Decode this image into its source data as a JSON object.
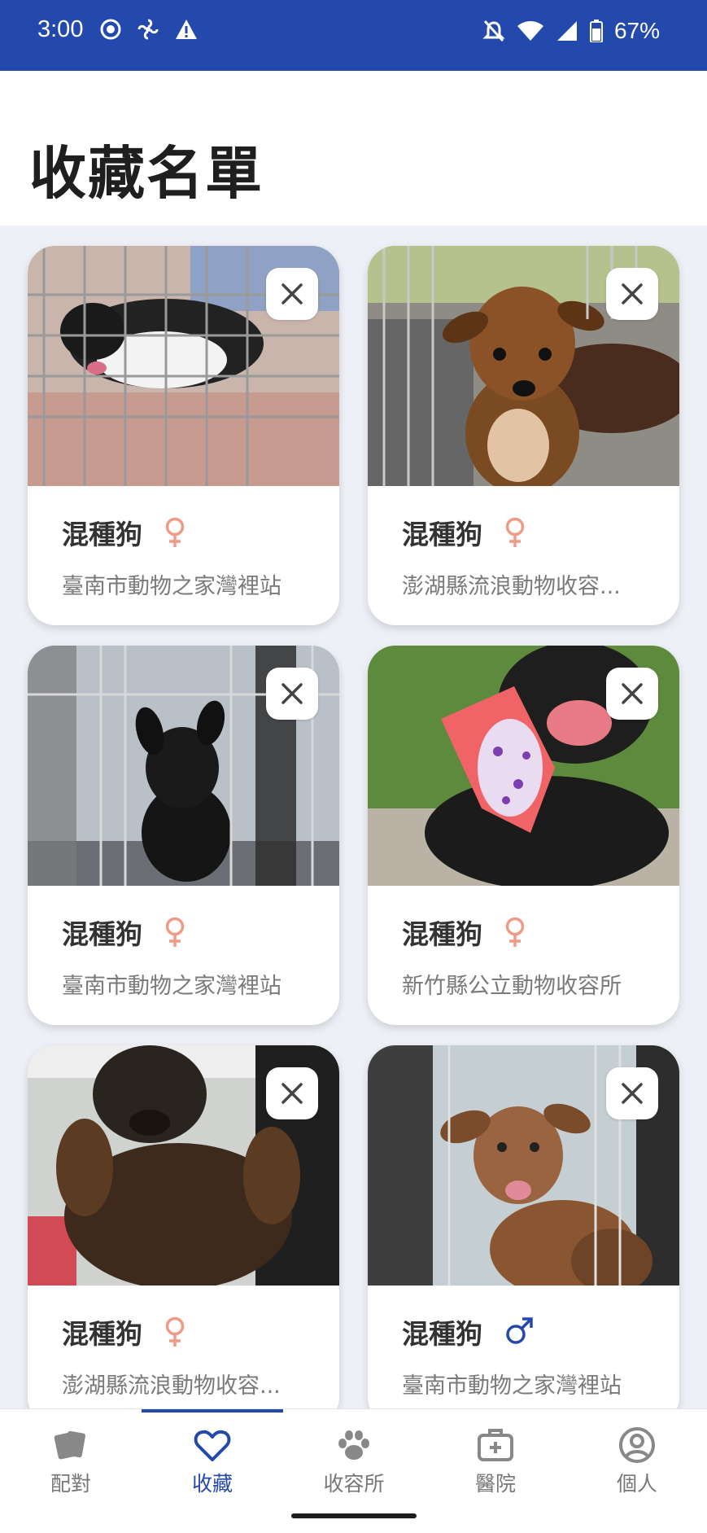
{
  "status_bar": {
    "time": "3:00",
    "battery": "67%"
  },
  "header": {
    "title": "收藏名單"
  },
  "cards": [
    {
      "name": "混種狗",
      "gender": "female",
      "gender_icon": "female-icon",
      "shelter": "臺南市動物之家灣裡站"
    },
    {
      "name": "混種狗",
      "gender": "female",
      "gender_icon": "female-icon",
      "shelter": "澎湖縣流浪動物收容..."
    },
    {
      "name": "混種狗",
      "gender": "female",
      "gender_icon": "female-icon",
      "shelter": "臺南市動物之家灣裡站"
    },
    {
      "name": "混種狗",
      "gender": "female",
      "gender_icon": "female-icon",
      "shelter": "新竹縣公立動物收容所"
    },
    {
      "name": "混種狗",
      "gender": "female",
      "gender_icon": "female-icon",
      "shelter": "澎湖縣流浪動物收容..."
    },
    {
      "name": "混種狗",
      "gender": "male",
      "gender_icon": "male-icon",
      "shelter": "臺南市動物之家灣裡站"
    }
  ],
  "nav": {
    "items": [
      {
        "label": "配對",
        "icon": "cards-icon"
      },
      {
        "label": "收藏",
        "icon": "heart-icon"
      },
      {
        "label": "收容所",
        "icon": "paw-icon"
      },
      {
        "label": "醫院",
        "icon": "medical-kit-icon"
      },
      {
        "label": "個人",
        "icon": "profile-icon"
      }
    ],
    "active_index": 1
  },
  "colors": {
    "brand": "#2449ad",
    "female": "#ef9a86",
    "male": "#2449ad"
  }
}
